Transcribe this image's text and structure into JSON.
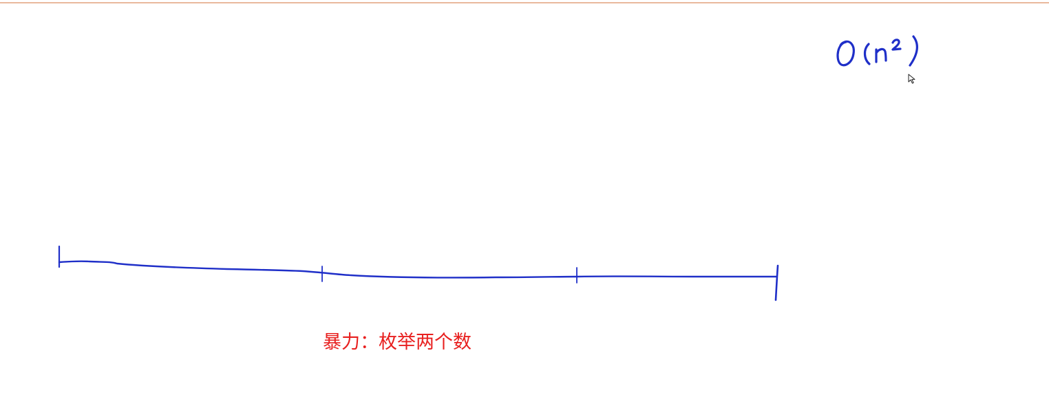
{
  "colors": {
    "ink": "#1f2fc8",
    "caption": "#e8201f",
    "top_rule": "#e9b99c",
    "background": "#ffffff"
  },
  "annotation": {
    "complexity_text": "O(n²)"
  },
  "caption": {
    "text": "暴力：枚举两个数"
  },
  "cursor": {
    "icon": "mouse-pointer-icon"
  }
}
